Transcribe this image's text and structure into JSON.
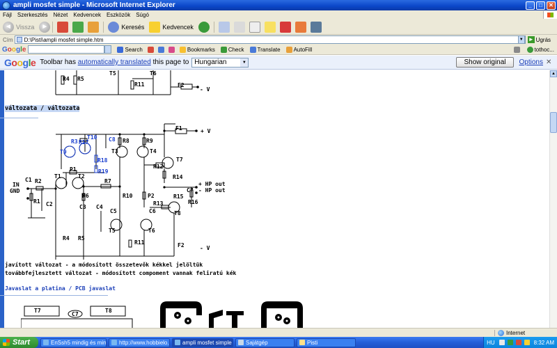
{
  "window": {
    "title": "ampli mosfet simple - Microsoft Internet Explorer"
  },
  "menu": [
    "Fájl",
    "Szerkesztés",
    "Nézet",
    "Kedvencek",
    "Eszközök",
    "Súgó"
  ],
  "nav": {
    "back": "Vissza",
    "search": "Keresés",
    "favorites": "Kedvencek"
  },
  "address": {
    "label": "Cím",
    "url": "D:\\Pisti\\ampli mosfet simple.htm",
    "go": "Ugrás"
  },
  "google_toolbar": {
    "logo": "Google",
    "search": "Search",
    "bookmarks": "Bookmarks",
    "check": "Check",
    "translate": "Translate",
    "autofill": "AutoFill",
    "user": "tothoc..."
  },
  "translate_bar": {
    "logo": "Google",
    "text_before": "Toolbar has ",
    "link": "automatically translated",
    "text_after": " this page to",
    "language": "Hungarian",
    "show_original": "Show original",
    "options": "Options"
  },
  "page": {
    "variant": "változata / változata",
    "improved": "javított változat - a módosított összetevők kékkel jelöltük",
    "developed": "továbbfejlesztett változat - módosított compoment vannak feliratú kék",
    "pcb_heading": "Javaslat a platina / PCB javaslat",
    "labels_top": {
      "r4": "R4",
      "r5": "R5",
      "t5": "T5",
      "t6": "T6",
      "r11": "R11",
      "f2": "F2",
      "vneg": "- V"
    },
    "schematic": {
      "f1": "F1",
      "vpos": "+ V",
      "vneg": "- V",
      "f2": "F2",
      "r3": "R3",
      "r17": "R17",
      "t10": "T10",
      "c8": "C8",
      "t9": "T9",
      "r18": "R18",
      "r19": "R19",
      "r8": "R8",
      "r9": "R9",
      "t3": "T3",
      "t4": "T4",
      "t7": "T7",
      "r12": "R12",
      "r14": "R14",
      "p1": "P1",
      "t1": "T1",
      "t2": "T2",
      "in": "IN",
      "gnd": "GND",
      "c1": "C1",
      "r2": "R2",
      "r1": "R1",
      "c2": "C2",
      "r6": "R6",
      "r7": "R7",
      "c3c4": "C3",
      "c4": "C4",
      "r10": "R10",
      "p2": "P2",
      "hp_out": "+ HP out",
      "hp_out_neg": "- HP out",
      "c7": "C7",
      "r15": "R15",
      "r16": "R16",
      "r13": "R13",
      "c5": "C5",
      "c6": "C6",
      "t8": "T8",
      "t5": "T5",
      "t6": "T6",
      "r4": "R4",
      "r5": "R5",
      "r11": "R11"
    },
    "pcb": {
      "t7": "T7",
      "c7": "C7",
      "t8": "T8"
    }
  },
  "status": {
    "zone": "Internet"
  },
  "taskbar": {
    "start": "Start",
    "tasks": [
      "EnSsh5 mindig és min...",
      "http://www.hobbielo...",
      "ampli mosfet simple -...",
      "Sajátgép",
      "Pisti"
    ],
    "lang": "HU",
    "clock": "8:32 AM"
  },
  "colors": {
    "blue_text": "#1b3fb8",
    "blue_schematic": "#1a3fd0",
    "highlight": "#c6d8f5"
  }
}
